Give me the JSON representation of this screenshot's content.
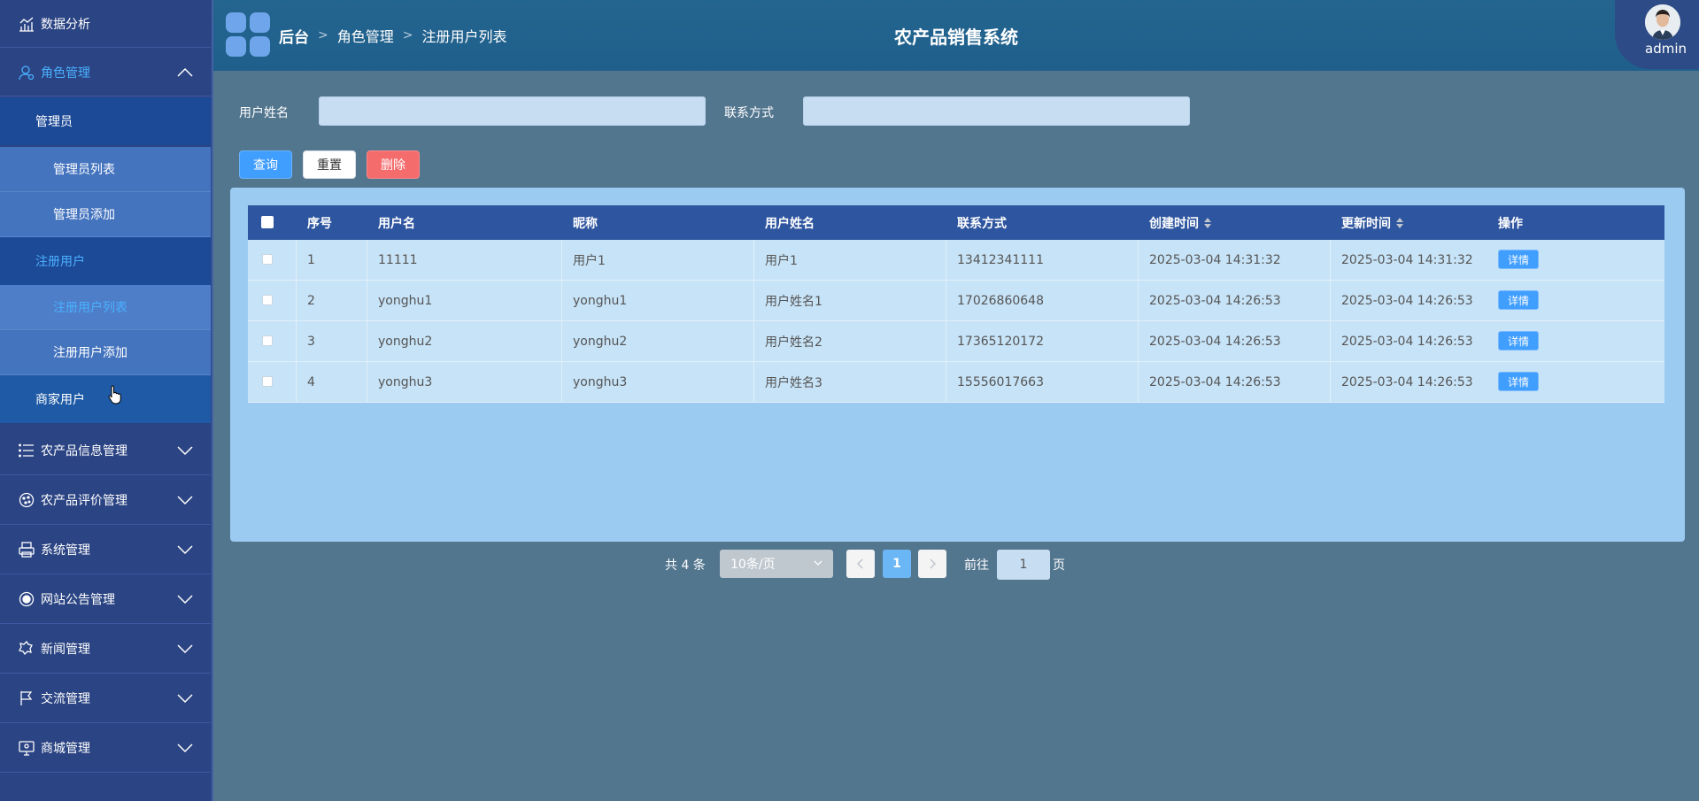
{
  "sidebar": {
    "items": [
      {
        "label": "数据分析",
        "icon": "chart-icon"
      },
      {
        "label": "角色管理",
        "icon": "user-icon"
      },
      {
        "label": "农产品信息管理",
        "icon": "list-icon"
      },
      {
        "label": "农产品评价管理",
        "icon": "cookie-icon"
      },
      {
        "label": "系统管理",
        "icon": "printer-icon"
      },
      {
        "label": "网站公告管理",
        "icon": "notice-icon"
      },
      {
        "label": "新闻管理",
        "icon": "news-icon"
      },
      {
        "label": "交流管理",
        "icon": "flag-icon"
      },
      {
        "label": "商城管理",
        "icon": "monitor-icon"
      }
    ],
    "role_sub": {
      "admin_group": "管理员",
      "admin_list": "管理员列表",
      "admin_add": "管理员添加",
      "user_group": "注册用户",
      "user_list": "注册用户列表",
      "user_add": "注册用户添加",
      "merchant_group": "商家用户"
    }
  },
  "header": {
    "breadcrumb": [
      "后台",
      "角色管理",
      "注册用户列表"
    ],
    "title": "农产品销售系统",
    "user": "admin"
  },
  "search": {
    "name_label": "用户姓名",
    "name_value": "",
    "contact_label": "联系方式",
    "contact_value": ""
  },
  "actions": {
    "query": "查询",
    "reset": "重置",
    "delete": "删除"
  },
  "table": {
    "columns": [
      "序号",
      "用户名",
      "昵称",
      "用户姓名",
      "联系方式",
      "创建时间",
      "更新时间",
      "操作"
    ],
    "detail_label": "详情",
    "rows": [
      {
        "no": "1",
        "username": "11111",
        "nickname": "用户1",
        "realname": "用户1",
        "phone": "13412341111",
        "created": "2025-03-04 14:31:32",
        "updated": "2025-03-04 14:31:32"
      },
      {
        "no": "2",
        "username": "yonghu1",
        "nickname": "yonghu1",
        "realname": "用户姓名1",
        "phone": "17026860648",
        "created": "2025-03-04 14:26:53",
        "updated": "2025-03-04 14:26:53"
      },
      {
        "no": "3",
        "username": "yonghu2",
        "nickname": "yonghu2",
        "realname": "用户姓名2",
        "phone": "17365120172",
        "created": "2025-03-04 14:26:53",
        "updated": "2025-03-04 14:26:53"
      },
      {
        "no": "4",
        "username": "yonghu3",
        "nickname": "yonghu3",
        "realname": "用户姓名3",
        "phone": "15556017663",
        "created": "2025-03-04 14:26:53",
        "updated": "2025-03-04 14:26:53"
      }
    ]
  },
  "pagination": {
    "total": "共 4 条",
    "page_size": "10条/页",
    "current": "1",
    "goto_label": "前往",
    "goto_value": "1",
    "page_suffix": "页"
  },
  "colors": {
    "accent": "#409eff",
    "danger": "#f56c6c",
    "sidebar": "#2b4483",
    "active_text": "#4ab0ff"
  }
}
